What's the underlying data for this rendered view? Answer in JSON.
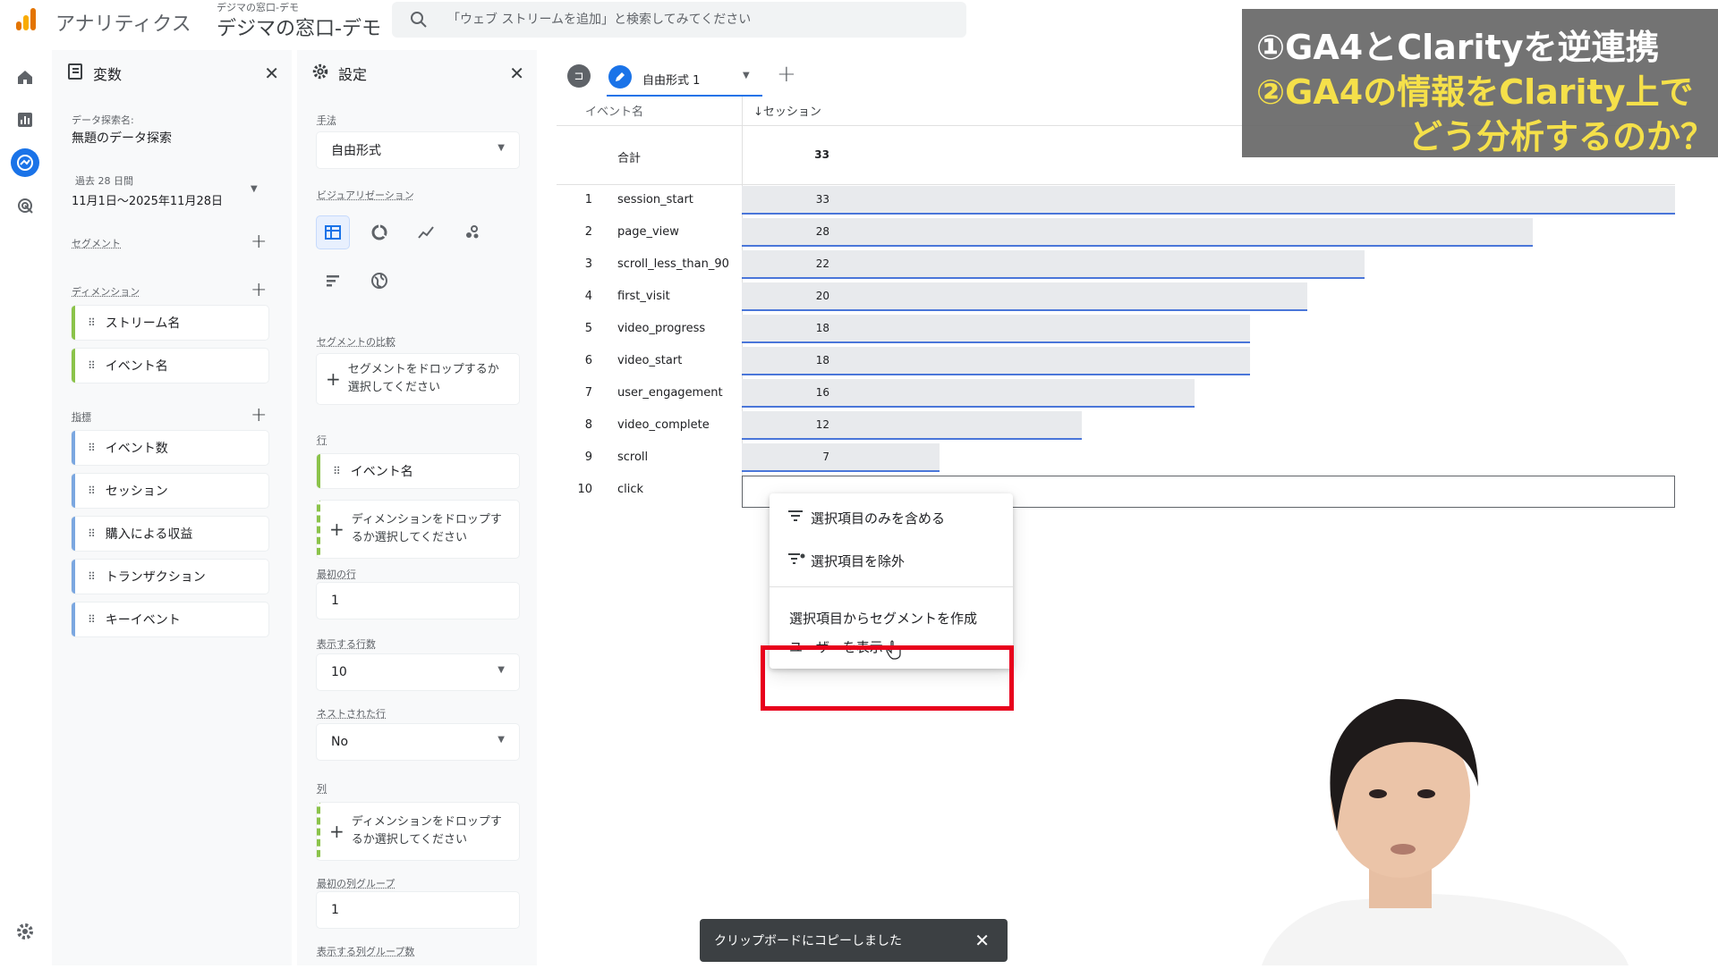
{
  "header": {
    "app_name": "アナリティクス",
    "property_sub": "デジマの窓口-デモ",
    "property_name": "デジマの窓口-デモ",
    "search_placeholder": "「ウェブ ストリームを追加」と検索してみてください"
  },
  "variables_panel": {
    "title": "変数",
    "exploration_label": "データ探索名:",
    "exploration_name": "無題のデータ探索",
    "date_label": "過去 28 日間",
    "date_range": "11月1日～2025年11月28日",
    "segment_label": "セグメント",
    "dimension_label": "ディメンション",
    "dimensions": [
      "ストリーム名",
      "イベント名"
    ],
    "metric_label": "指標",
    "metrics": [
      "イベント数",
      "セッション",
      "購入による収益",
      "トランザクション",
      "キーイベント"
    ]
  },
  "settings_panel": {
    "title": "設定",
    "technique_label": "手法",
    "technique_value": "自由形式",
    "viz_label": "ビジュアリゼーション",
    "segment_compare_label": "セグメントの比較",
    "segment_drop": "セグメントをドロップするか選択してください",
    "rows_label": "行",
    "row_chip": "イベント名",
    "dimension_drop": "ディメンションをドロップするか選択してください",
    "first_row_label": "最初の行",
    "first_row_value": "1",
    "show_rows_label": "表示する行数",
    "show_rows_value": "10",
    "nested_label": "ネストされた行",
    "nested_value": "No",
    "columns_label": "列",
    "column_drop": "ディメンションをドロップするか選択してください",
    "first_col_group_label": "最初の列グループ",
    "first_col_group_value": "1",
    "show_col_groups_label": "表示する列グループ数"
  },
  "tabs": {
    "tab1_label": "自由形式 1",
    "add_symbol": "+"
  },
  "table": {
    "col_event": "イベント名",
    "col_session": "↓セッション",
    "total_label": "合計",
    "total_value": "33",
    "rows": [
      {
        "num": "1",
        "name": "session_start",
        "value": "33",
        "frac": 1.0
      },
      {
        "num": "2",
        "name": "page_view",
        "value": "28",
        "frac": 0.848
      },
      {
        "num": "3",
        "name": "scroll_less_than_90",
        "value": "22",
        "frac": 0.667
      },
      {
        "num": "4",
        "name": "first_visit",
        "value": "20",
        "frac": 0.606
      },
      {
        "num": "5",
        "name": "video_progress",
        "value": "18",
        "frac": 0.545
      },
      {
        "num": "6",
        "name": "video_start",
        "value": "18",
        "frac": 0.545
      },
      {
        "num": "7",
        "name": "user_engagement",
        "value": "16",
        "frac": 0.485
      },
      {
        "num": "8",
        "name": "video_complete",
        "value": "12",
        "frac": 0.364
      },
      {
        "num": "9",
        "name": "scroll",
        "value": "7",
        "frac": 0.212
      },
      {
        "num": "10",
        "name": "click",
        "value": "",
        "frac": 0.0
      }
    ]
  },
  "context_menu": {
    "include_only": "選択項目のみを含める",
    "exclude": "選択項目を除外",
    "create_segment": "選択項目からセグメントを作成",
    "view_users": "ユーザーを表示"
  },
  "caption": {
    "line1": "①GA4とClarityを逆連携",
    "line2": "②GA4の情報をClarity上で",
    "line3": "どう分析するのか？"
  },
  "toast": {
    "message": "クリップボードにコピーしました"
  },
  "colors": {
    "accent_blue": "#1a73e8",
    "bar_line": "#4a76d9",
    "dimension_green": "#8bc34a",
    "metric_blue": "#7ba7e0",
    "highlight_red": "#e8001c",
    "caption_white": "#ffffff",
    "caption_yellow": "#f5e04a"
  }
}
